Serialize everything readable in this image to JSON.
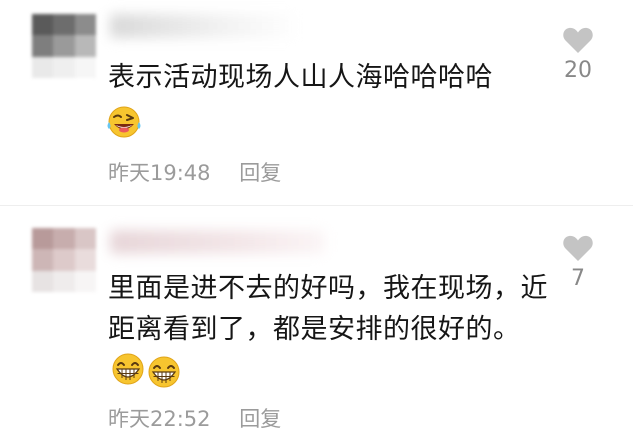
{
  "comments": [
    {
      "text": "表示活动现场人山人海哈哈哈哈",
      "time": "昨天19:48",
      "reply_label": "回复",
      "like_count": "20",
      "emojis": [
        "laughing-wink"
      ]
    },
    {
      "text": "里面是进不去的好吗，我在现场，近距离看到了，都是安排的很好的。",
      "time": "昨天22:52",
      "reply_label": "回复",
      "like_count": "7",
      "emojis": [
        "grin",
        "grin"
      ]
    }
  ],
  "icons": {
    "like": "heart-icon",
    "emoji_1": "laughing-wink-emoji",
    "emoji_2": "grin-emoji"
  },
  "colors": {
    "text": "#161616",
    "meta": "#9b9b9b",
    "heart": "#c4c4c4",
    "emoji_face": "#f7c52f"
  }
}
